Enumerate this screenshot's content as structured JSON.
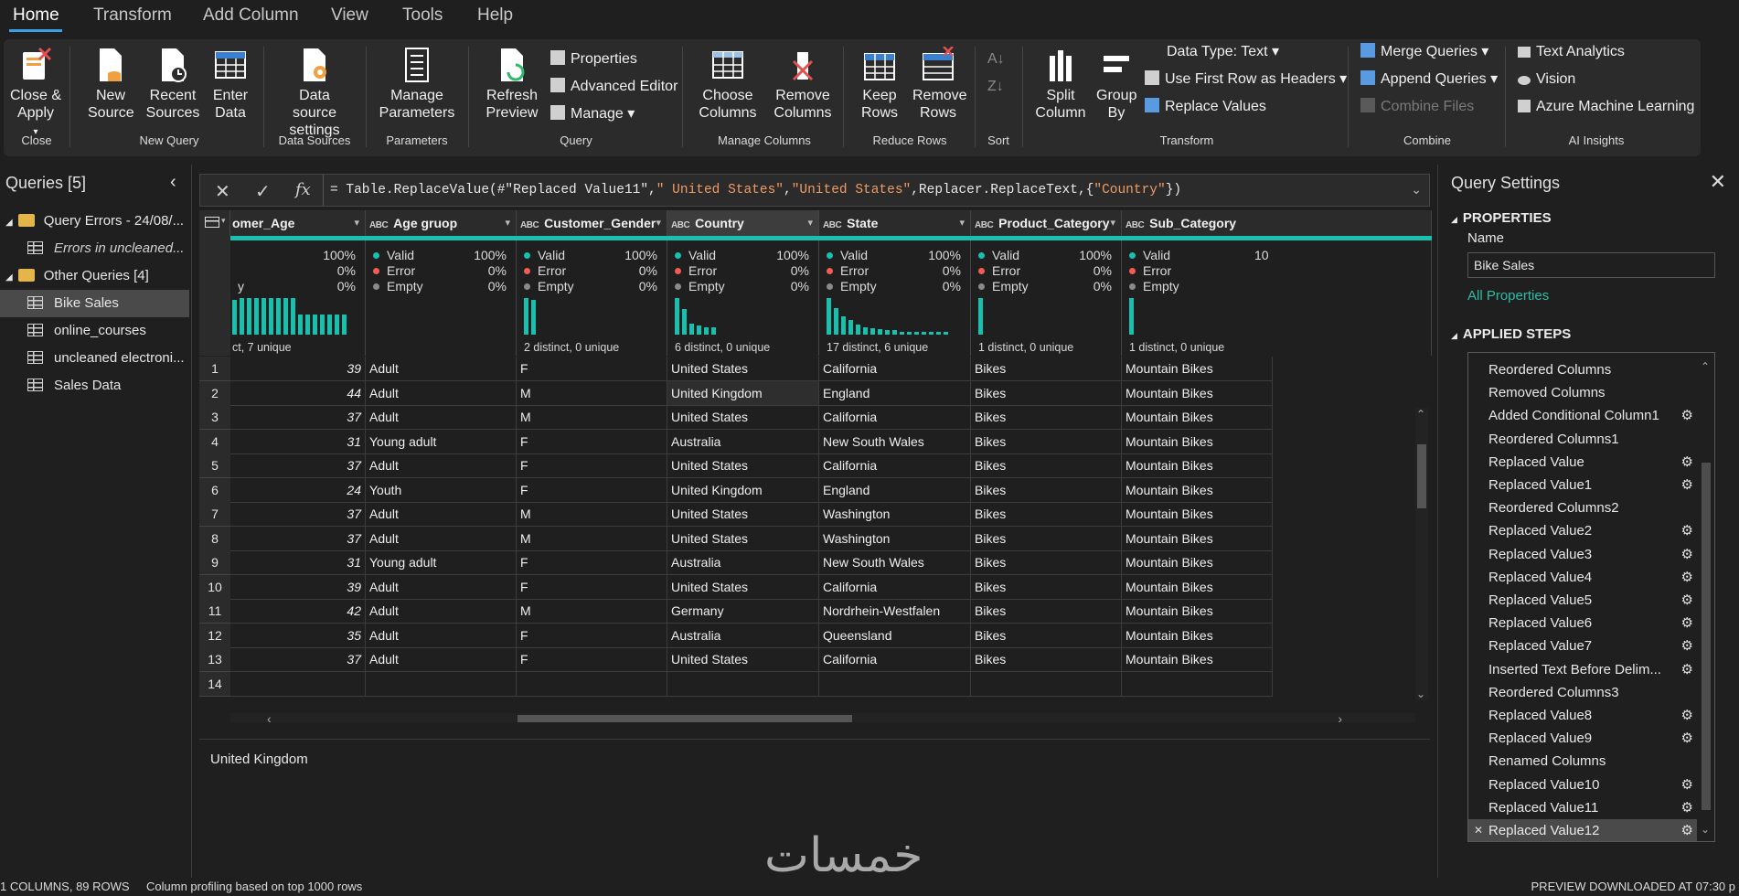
{
  "menu": {
    "tabs": [
      "Home",
      "Transform",
      "Add Column",
      "View",
      "Tools",
      "Help"
    ],
    "active": "Home"
  },
  "ribbon": {
    "close_apply": "Close & Apply",
    "new_source": "New Source",
    "recent_sources": "Recent Sources",
    "enter_data": "Enter Data",
    "data_source_settings": "Data source settings",
    "manage_parameters": "Manage Parameters",
    "refresh_preview": "Refresh Preview",
    "properties": "Properties",
    "advanced_editor": "Advanced Editor",
    "manage": "Manage",
    "choose_columns": "Choose Columns",
    "remove_columns": "Remove Columns",
    "keep_rows": "Keep Rows",
    "remove_rows": "Remove Rows",
    "split_column": "Split Column",
    "group_by": "Group By",
    "data_type": "Data Type: Text",
    "use_first_row": "Use First Row as Headers",
    "replace_values": "Replace Values",
    "merge_queries": "Merge Queries",
    "append_queries": "Append Queries",
    "combine_files": "Combine Files",
    "text_analytics": "Text Analytics",
    "vision": "Vision",
    "azure_ml": "Azure Machine Learning",
    "groups": [
      "Close",
      "New Query",
      "Data Sources",
      "Parameters",
      "Query",
      "Manage Columns",
      "Reduce Rows",
      "Sort",
      "Transform",
      "Combine",
      "AI Insights"
    ]
  },
  "queries": {
    "title": "Queries [5]",
    "items": [
      {
        "label": "Query Errors - 24/08/...",
        "kind": "folder"
      },
      {
        "label": "Errors in uncleaned...",
        "kind": "table-italic"
      },
      {
        "label": "Other Queries [4]",
        "kind": "folder"
      },
      {
        "label": "Bike Sales",
        "kind": "table",
        "selected": true
      },
      {
        "label": "online_courses",
        "kind": "table"
      },
      {
        "label": "uncleaned electroni...",
        "kind": "table"
      },
      {
        "label": "Sales Data",
        "kind": "table"
      }
    ]
  },
  "formula": {
    "prefix": "= Table.ReplaceValue(#\"Replaced Value11\",",
    "arg1": "\" United States\"",
    "comma1": ",",
    "arg2": "\"United States\"",
    "mid": ",Replacer.ReplaceText,{",
    "arg3": "\"Country\"",
    "suffix": "})"
  },
  "grid": {
    "columns": [
      {
        "name": "omer_Age",
        "type": "123",
        "valid": "100%",
        "error": "0%",
        "empty": "0%",
        "valid_label": "",
        "error_label": "",
        "empty_label": "y",
        "distinct": "ct, 7 unique"
      },
      {
        "name": "Age gruop",
        "type": "ABC123",
        "valid": "100%",
        "error": "0%",
        "empty": "0%",
        "valid_label": "Valid",
        "error_label": "Error",
        "empty_label": "Empty",
        "distinct": ""
      },
      {
        "name": "Customer_Gender",
        "type": "ABC",
        "valid": "100%",
        "error": "0%",
        "empty": "0%",
        "valid_label": "Valid",
        "error_label": "Error",
        "empty_label": "Empty",
        "distinct": "2 distinct, 0 unique"
      },
      {
        "name": "Country",
        "type": "ABC",
        "valid": "100%",
        "error": "0%",
        "empty": "0%",
        "valid_label": "Valid",
        "error_label": "Error",
        "empty_label": "Empty",
        "distinct": "6 distinct, 0 unique"
      },
      {
        "name": "State",
        "type": "ABC",
        "valid": "100%",
        "error": "0%",
        "empty": "0%",
        "valid_label": "Valid",
        "error_label": "Error",
        "empty_label": "Empty",
        "distinct": "17 distinct, 6 unique"
      },
      {
        "name": "Product_Category",
        "type": "ABC",
        "valid": "100%",
        "error": "0%",
        "empty": "0%",
        "valid_label": "Valid",
        "error_label": "Error",
        "empty_label": "Empty",
        "distinct": "1 distinct, 0 unique"
      },
      {
        "name": "Sub_Category",
        "type": "ABC",
        "valid": "10",
        "error": "",
        "empty": "",
        "valid_label": "Valid",
        "error_label": "Error",
        "empty_label": "Empty",
        "distinct": "1 distinct, 0 unique"
      }
    ],
    "rows": [
      [
        "1",
        "39",
        "Adult",
        "F",
        "United States",
        "California",
        "Bikes",
        "Mountain Bikes"
      ],
      [
        "2",
        "44",
        "Adult",
        "M",
        "United Kingdom",
        "England",
        "Bikes",
        "Mountain Bikes"
      ],
      [
        "3",
        "37",
        "Adult",
        "M",
        "United States",
        "California",
        "Bikes",
        "Mountain Bikes"
      ],
      [
        "4",
        "31",
        "Young adult",
        "F",
        "Australia",
        "New South Wales",
        "Bikes",
        "Mountain Bikes"
      ],
      [
        "5",
        "37",
        "Adult",
        "F",
        "United States",
        "California",
        "Bikes",
        "Mountain Bikes"
      ],
      [
        "6",
        "24",
        "Youth",
        "F",
        "United Kingdom",
        "England",
        "Bikes",
        "Mountain Bikes"
      ],
      [
        "7",
        "37",
        "Adult",
        "M",
        "United States",
        "Washington",
        "Bikes",
        "Mountain Bikes"
      ],
      [
        "8",
        "37",
        "Adult",
        "M",
        "United States",
        "Washington",
        "Bikes",
        "Mountain Bikes"
      ],
      [
        "9",
        "31",
        "Young adult",
        "F",
        "Australia",
        "New South Wales",
        "Bikes",
        "Mountain Bikes"
      ],
      [
        "10",
        "39",
        "Adult",
        "F",
        "United States",
        "California",
        "Bikes",
        "Mountain Bikes"
      ],
      [
        "11",
        "42",
        "Adult",
        "M",
        "Germany",
        "Nordrhein-Westfalen",
        "Bikes",
        "Mountain Bikes"
      ],
      [
        "12",
        "35",
        "Adult",
        "F",
        "Australia",
        "Queensland",
        "Bikes",
        "Mountain Bikes"
      ],
      [
        "13",
        "37",
        "Adult",
        "F",
        "United States",
        "California",
        "Bikes",
        "Mountain Bikes"
      ],
      [
        "14",
        "",
        "",
        "",
        "",
        "",
        "",
        ""
      ]
    ]
  },
  "preview_value": "United Kingdom",
  "settings": {
    "title": "Query Settings",
    "properties_heading": "PROPERTIES",
    "name_label": "Name",
    "name_value": "Bike Sales",
    "all_properties": "All Properties",
    "applied_heading": "APPLIED STEPS",
    "steps": [
      {
        "label": "Reordered Columns",
        "gear": false
      },
      {
        "label": "Removed Columns",
        "gear": false
      },
      {
        "label": "Added Conditional Column1",
        "gear": true
      },
      {
        "label": "Reordered Columns1",
        "gear": false
      },
      {
        "label": "Replaced Value",
        "gear": true
      },
      {
        "label": "Replaced Value1",
        "gear": true
      },
      {
        "label": "Reordered Columns2",
        "gear": false
      },
      {
        "label": "Replaced Value2",
        "gear": true
      },
      {
        "label": "Replaced Value3",
        "gear": true
      },
      {
        "label": "Replaced Value4",
        "gear": true
      },
      {
        "label": "Replaced Value5",
        "gear": true
      },
      {
        "label": "Replaced Value6",
        "gear": true
      },
      {
        "label": "Replaced Value7",
        "gear": true
      },
      {
        "label": "Inserted Text Before Delim...",
        "gear": true
      },
      {
        "label": "Reordered Columns3",
        "gear": false
      },
      {
        "label": "Replaced Value8",
        "gear": true
      },
      {
        "label": "Replaced Value9",
        "gear": true
      },
      {
        "label": "Renamed Columns",
        "gear": false
      },
      {
        "label": "Replaced Value10",
        "gear": true
      },
      {
        "label": "Replaced Value11",
        "gear": true
      },
      {
        "label": "Replaced Value12",
        "gear": true,
        "selected": true
      }
    ]
  },
  "status": {
    "left": "1 COLUMNS, 89 ROWS",
    "profiling": "Column profiling based on top 1000 rows",
    "right": "PREVIEW DOWNLOADED AT 07:30 p"
  },
  "watermark": "خمسات",
  "colors": {
    "accent": "#3aa0e8",
    "teal": "#18c0ad",
    "error_dot": "#f25c54",
    "empty_dot": "#8a8a8a",
    "string_literal": "#f09b64",
    "folder": "#e4b54a"
  },
  "distributions": {
    "c0": [
      0.95,
      1,
      1,
      1,
      1,
      1,
      1,
      1,
      1,
      0.55,
      0.55,
      0.55,
      0.55,
      0.55,
      0.55,
      0.55
    ],
    "c2": [
      1,
      0.95
    ],
    "c3": [
      1,
      0.7,
      0.3,
      0.25,
      0.2,
      0.2
    ],
    "c4": [
      1,
      0.72,
      0.5,
      0.4,
      0.28,
      0.2,
      0.18,
      0.15,
      0.12,
      0.12,
      0.08,
      0.08,
      0.08,
      0.08,
      0.08,
      0.08,
      0.08
    ],
    "c5": [
      1
    ],
    "c6": [
      1
    ]
  }
}
